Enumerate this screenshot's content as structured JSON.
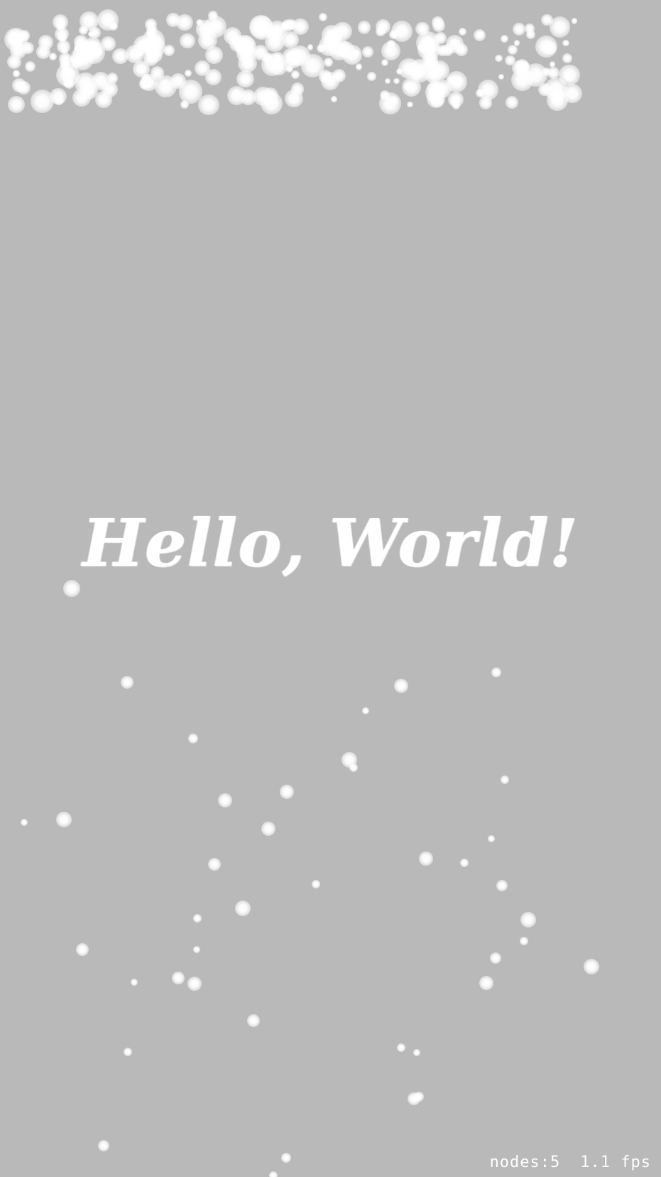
{
  "scene": {
    "label": "Hello, World!",
    "background_color": "#b9b9b9",
    "text_color": "#ffffff",
    "particle_color": "#ffffff"
  },
  "debug_overlay": {
    "nodes_text": "nodes:5",
    "fps_text": "1.1 fps"
  }
}
